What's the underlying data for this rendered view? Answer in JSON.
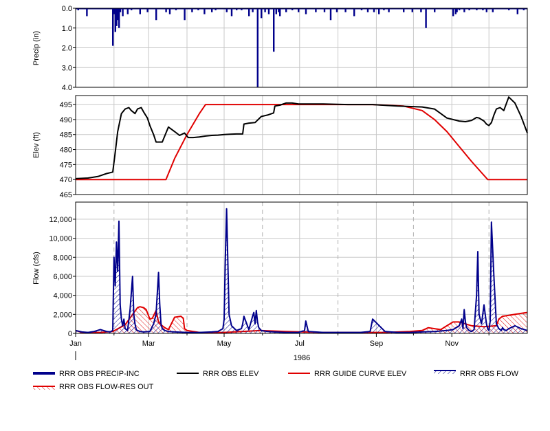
{
  "colors": {
    "precip": "#00008b",
    "elev": "#000000",
    "guide": "#e00000",
    "flow": "#00008b",
    "res_out": "#e00000",
    "grid": "#c8c8c8",
    "frame": "#000000"
  },
  "chart_data": [
    {
      "type": "bar",
      "ylabel": "Precip (in)",
      "yticks": [
        "0.0",
        "1.0",
        "2.0",
        "3.0",
        "4.0"
      ],
      "ylim": [
        0,
        4
      ],
      "inverted": true,
      "xlim": [
        0,
        365
      ],
      "series": [
        {
          "name": "RRR OBS PRECIP-INC",
          "x": [
            2,
            9,
            30,
            31,
            32,
            33,
            34,
            35,
            36,
            38,
            42,
            45,
            52,
            58,
            65,
            73,
            76,
            81,
            88,
            94,
            99,
            104,
            110,
            113,
            122,
            126,
            130,
            134,
            140,
            143,
            147,
            150,
            153,
            156,
            160,
            162,
            164,
            165,
            170,
            175,
            180,
            186,
            194,
            201,
            206,
            211,
            218,
            225,
            231,
            236,
            241,
            245,
            249,
            253,
            265,
            272,
            279,
            283,
            290,
            305,
            307,
            308,
            310,
            314,
            318,
            324,
            329,
            332,
            337,
            350,
            357,
            362
          ],
          "values": [
            0.1,
            0.4,
            1.9,
            0.3,
            1.2,
            0.9,
            0.6,
            1.0,
            0.2,
            0.4,
            0.3,
            0.1,
            0.3,
            0.2,
            0.6,
            0.2,
            0.3,
            0.1,
            0.6,
            0.2,
            0.1,
            0.3,
            0.2,
            0.1,
            0.2,
            0.4,
            0.1,
            0.1,
            0.4,
            0.2,
            4.0,
            0.5,
            0.2,
            0.3,
            2.2,
            0.3,
            0.2,
            0.4,
            0.2,
            0.1,
            0.2,
            0.3,
            0.2,
            0.2,
            0.6,
            0.2,
            0.2,
            0.4,
            0.1,
            0.2,
            0.2,
            0.3,
            0.1,
            0.2,
            0.2,
            0.2,
            0.2,
            1.0,
            0.2,
            0.4,
            0.3,
            0.2,
            0.1,
            0.2,
            0.1,
            0.1,
            0.1,
            0.2,
            0.2,
            0.1,
            0.3,
            0.1
          ]
        }
      ]
    },
    {
      "type": "line",
      "ylabel": "Elev (ft)",
      "yticks": [
        "465",
        "470",
        "475",
        "480",
        "485",
        "490",
        "495"
      ],
      "ylim": [
        465,
        498
      ],
      "xlim": [
        0,
        365
      ],
      "series": [
        {
          "name": "RRR OBS ELEV",
          "x": [
            0,
            10,
            18,
            25,
            30,
            32,
            34,
            37,
            40,
            43,
            45,
            48,
            50,
            53,
            55,
            58,
            60,
            63,
            65,
            70,
            75,
            80,
            84,
            88,
            91,
            95,
            100,
            105,
            110,
            115,
            120,
            125,
            130,
            135,
            136,
            140,
            145,
            150,
            155,
            160,
            161,
            165,
            170,
            175,
            180,
            200,
            220,
            240,
            260,
            280,
            290,
            300,
            310,
            315,
            320,
            322,
            324,
            326,
            328,
            330,
            332,
            334,
            336,
            338,
            340,
            343,
            346,
            350,
            355,
            360,
            365
          ],
          "values": [
            470.3,
            470.5,
            471.0,
            472.0,
            472.5,
            479.0,
            486.0,
            492.0,
            493.5,
            494.0,
            493.0,
            492.0,
            493.5,
            494.0,
            492.5,
            490.5,
            488.0,
            485.0,
            482.5,
            482.5,
            487.5,
            486.0,
            484.7,
            485.5,
            484.0,
            484.0,
            484.2,
            484.5,
            484.7,
            484.8,
            485.0,
            485.1,
            485.2,
            485.2,
            488.5,
            488.8,
            489.0,
            491.0,
            491.5,
            492.2,
            494.5,
            494.8,
            495.5,
            495.5,
            495.2,
            495.2,
            495.0,
            495.0,
            494.5,
            494.2,
            493.5,
            490.5,
            489.5,
            489.3,
            489.7,
            490.2,
            490.7,
            490.5,
            490.0,
            489.5,
            488.5,
            488.0,
            489.0,
            491.5,
            493.5,
            494.0,
            493.0,
            497.5,
            495.5,
            491.0,
            485.5
          ]
        },
        {
          "name": "RRR GUIDE CURVE ELEV",
          "x": [
            0,
            73,
            80,
            90,
            100,
            105,
            240,
            265,
            280,
            290,
            300,
            310,
            320,
            333,
            365
          ],
          "values": [
            470,
            470,
            477,
            485,
            492,
            495,
            495,
            494.5,
            493,
            490,
            486,
            481,
            476,
            470,
            470
          ]
        }
      ]
    },
    {
      "type": "area",
      "ylabel": "Flow (cfs)",
      "yticks": [
        "0",
        "2,000",
        "4,000",
        "6,000",
        "8,000",
        "10,000",
        "12,000"
      ],
      "ylim": [
        0,
        13800
      ],
      "xlim": [
        0,
        365
      ],
      "x_tick_labels": [
        "Jan",
        "Mar",
        "May",
        "Jul",
        "Sep",
        "Nov"
      ],
      "x_tick_days": [
        0,
        59,
        120,
        181,
        243,
        304
      ],
      "minor_tick_days": [
        31,
        90,
        151,
        212,
        273,
        334
      ],
      "year_label": "1986",
      "series": [
        {
          "name": "RRR OBS FLOW",
          "x": [
            0,
            5,
            10,
            15,
            20,
            25,
            28,
            30,
            31,
            32,
            33,
            34,
            35,
            36,
            37,
            38,
            39,
            40,
            42,
            44,
            46,
            47,
            48,
            49,
            50,
            52,
            55,
            60,
            63,
            65,
            67,
            68,
            69,
            70,
            72,
            75,
            80,
            90,
            100,
            110,
            115,
            119,
            120,
            121,
            122,
            124,
            126,
            130,
            134,
            135,
            136,
            140,
            143,
            144,
            145,
            146,
            147,
            148,
            150,
            155,
            160,
            170,
            180,
            185,
            186,
            188,
            200,
            210,
            220,
            230,
            238,
            240,
            250,
            260,
            270,
            280,
            290,
            300,
            305,
            310,
            312,
            313,
            314,
            315,
            316,
            318,
            320,
            322,
            324,
            325,
            326,
            328,
            330,
            332,
            333,
            334,
            335,
            336,
            338,
            340,
            342,
            344,
            345,
            346,
            348,
            350,
            355,
            360,
            365
          ],
          "values": [
            300,
            150,
            100,
            200,
            400,
            200,
            150,
            300,
            8000,
            5000,
            9600,
            6500,
            11800,
            3000,
            1500,
            800,
            1500,
            500,
            300,
            2500,
            6000,
            2000,
            1000,
            400,
            300,
            200,
            150,
            200,
            1000,
            2000,
            6400,
            3000,
            1000,
            500,
            300,
            200,
            150,
            100,
            100,
            150,
            200,
            500,
            1500,
            8000,
            13100,
            2000,
            800,
            300,
            500,
            1000,
            1800,
            400,
            1800,
            2200,
            1000,
            2400,
            1200,
            600,
            300,
            200,
            150,
            100,
            100,
            300,
            1300,
            200,
            100,
            100,
            100,
            100,
            200,
            1500,
            200,
            100,
            100,
            150,
            200,
            300,
            400,
            800,
            1500,
            500,
            2500,
            1200,
            600,
            300,
            200,
            400,
            4000,
            8600,
            2000,
            1000,
            3000,
            1000,
            500,
            300,
            1300,
            11700,
            6000,
            1000,
            500,
            300,
            600,
            400,
            300,
            500,
            800,
            500,
            300
          ]
        },
        {
          "name": "RRR OBS FLOW-RES OUT",
          "x": [
            0,
            5,
            10,
            20,
            30,
            40,
            45,
            50,
            52,
            55,
            57,
            60,
            62,
            65,
            67,
            70,
            72,
            75,
            80,
            85,
            87,
            88,
            90,
            95,
            100,
            120,
            150,
            170,
            200,
            250,
            270,
            280,
            285,
            290,
            295,
            300,
            305,
            310,
            315,
            320,
            330,
            340,
            342,
            345,
            350,
            355,
            360,
            365
          ],
          "values": [
            300,
            100,
            100,
            100,
            200,
            900,
            1800,
            2700,
            2800,
            2700,
            2500,
            1500,
            1600,
            2400,
            1200,
            800,
            600,
            400,
            1700,
            1800,
            1600,
            500,
            300,
            200,
            100,
            100,
            300,
            200,
            100,
            100,
            200,
            300,
            600,
            500,
            400,
            800,
            1200,
            1200,
            1000,
            800,
            700,
            800,
            1500,
            1800,
            1900,
            2000,
            2100,
            2200
          ]
        }
      ]
    }
  ],
  "legend": [
    {
      "label": "RRR OBS PRECIP-INC",
      "style": "thick-line"
    },
    {
      "label": "RRR OBS ELEV",
      "style": "line"
    },
    {
      "label": "RRR GUIDE CURVE ELEV",
      "style": "line"
    },
    {
      "label": "RRR OBS FLOW",
      "style": "hatch-blue"
    },
    {
      "label": "RRR OBS FLOW-RES OUT",
      "style": "hatch-red"
    }
  ]
}
